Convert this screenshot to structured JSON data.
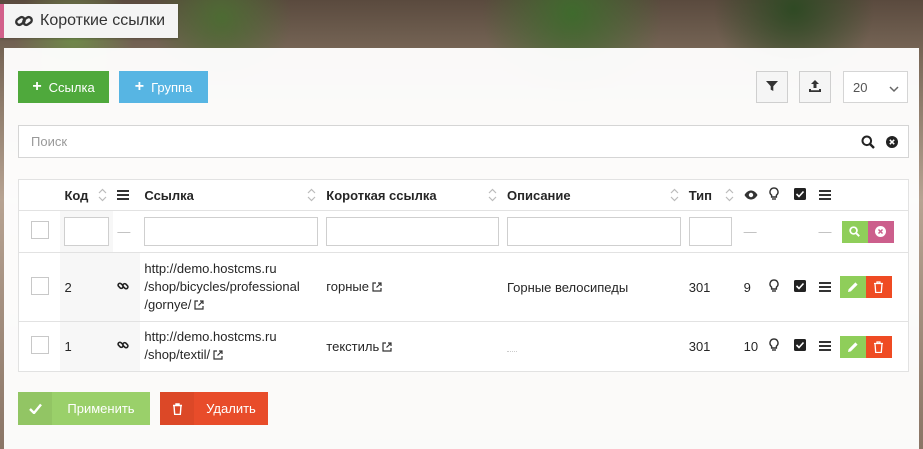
{
  "title": "Короткие ссылки",
  "toolbar": {
    "add_link": "Ссылка",
    "add_group": "Группа",
    "page_size": "20"
  },
  "search": {
    "placeholder": "Поиск"
  },
  "columns": {
    "code": "Код",
    "link": "Ссылка",
    "short": "Короткая ссылка",
    "description": "Описание",
    "type": "Тип"
  },
  "filter": {
    "dash1": "—",
    "dash2": "—",
    "dash3": "—"
  },
  "rows": [
    {
      "code": "2",
      "url_line1": "http://demo.hostcms.ru",
      "url_line2": "/shop/bicycles/professional",
      "url_line3": "/gornye/",
      "short": "горные",
      "description": "Горные велосипеды",
      "type": "301",
      "views": "9"
    },
    {
      "code": "1",
      "url_line1": "http://demo.hostcms.ru",
      "url_line2": "/shop/textil/",
      "url_line3": "",
      "short": "текстиль",
      "description": "",
      "type": "301",
      "views": "10"
    }
  ],
  "bottom": {
    "apply": "Применить",
    "delete": "Удалить"
  },
  "colors": {
    "green": "#4fa93c",
    "blue": "#57b5e3",
    "red": "#ef4b23",
    "pink": "#cc5f8c",
    "light_green": "#8fce5a"
  }
}
